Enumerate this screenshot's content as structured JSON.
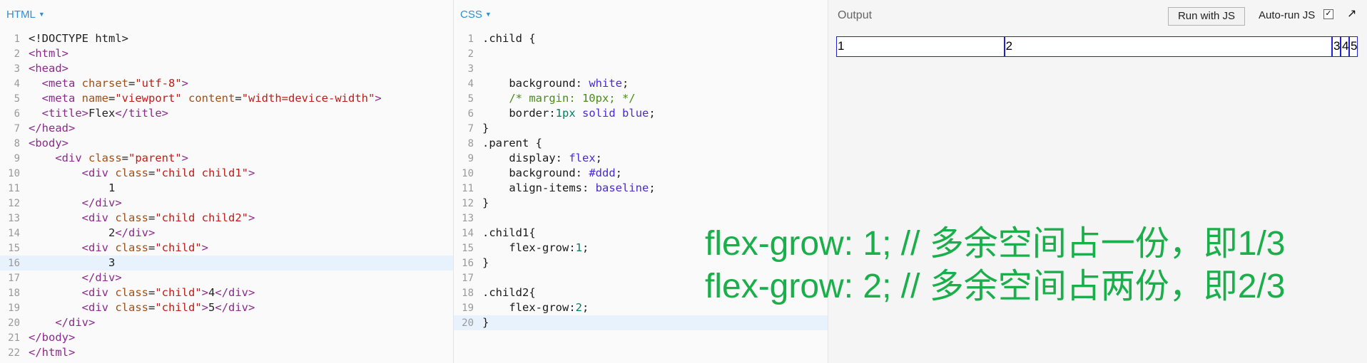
{
  "html_pane": {
    "header": "HTML",
    "lines": [
      {
        "n": "1",
        "tokens": [
          {
            "t": "<!DOCTYPE html>",
            "c": "tok-text"
          }
        ]
      },
      {
        "n": "2",
        "tokens": [
          {
            "t": "<html>",
            "c": "tok-tag"
          }
        ]
      },
      {
        "n": "3",
        "tokens": [
          {
            "t": "<head>",
            "c": "tok-tag"
          }
        ]
      },
      {
        "n": "4",
        "tokens": [
          {
            "t": "  ",
            "c": "tok-text"
          },
          {
            "t": "<meta ",
            "c": "tok-tag"
          },
          {
            "t": "charset",
            "c": "tok-attr"
          },
          {
            "t": "=",
            "c": "tok-text"
          },
          {
            "t": "\"utf-8\"",
            "c": "tok-str"
          },
          {
            "t": ">",
            "c": "tok-tag"
          }
        ]
      },
      {
        "n": "5",
        "tokens": [
          {
            "t": "  ",
            "c": "tok-text"
          },
          {
            "t": "<meta ",
            "c": "tok-tag"
          },
          {
            "t": "name",
            "c": "tok-attr"
          },
          {
            "t": "=",
            "c": "tok-text"
          },
          {
            "t": "\"viewport\"",
            "c": "tok-str"
          },
          {
            "t": " ",
            "c": "tok-text"
          },
          {
            "t": "content",
            "c": "tok-attr"
          },
          {
            "t": "=",
            "c": "tok-text"
          },
          {
            "t": "\"width=device-width\"",
            "c": "tok-str"
          },
          {
            "t": ">",
            "c": "tok-tag"
          }
        ]
      },
      {
        "n": "6",
        "tokens": [
          {
            "t": "  ",
            "c": "tok-text"
          },
          {
            "t": "<title>",
            "c": "tok-tag"
          },
          {
            "t": "Flex",
            "c": "tok-text"
          },
          {
            "t": "</title>",
            "c": "tok-tag"
          }
        ]
      },
      {
        "n": "7",
        "tokens": [
          {
            "t": "</head>",
            "c": "tok-tag"
          }
        ]
      },
      {
        "n": "8",
        "tokens": [
          {
            "t": "<body>",
            "c": "tok-tag"
          }
        ]
      },
      {
        "n": "9",
        "tokens": [
          {
            "t": "    ",
            "c": "tok-text"
          },
          {
            "t": "<div ",
            "c": "tok-tag"
          },
          {
            "t": "class",
            "c": "tok-attr"
          },
          {
            "t": "=",
            "c": "tok-text"
          },
          {
            "t": "\"parent\"",
            "c": "tok-str"
          },
          {
            "t": ">",
            "c": "tok-tag"
          }
        ]
      },
      {
        "n": "10",
        "tokens": [
          {
            "t": "        ",
            "c": "tok-text"
          },
          {
            "t": "<div ",
            "c": "tok-tag"
          },
          {
            "t": "class",
            "c": "tok-attr"
          },
          {
            "t": "=",
            "c": "tok-text"
          },
          {
            "t": "\"child child1\"",
            "c": "tok-str"
          },
          {
            "t": ">",
            "c": "tok-tag"
          }
        ]
      },
      {
        "n": "11",
        "tokens": [
          {
            "t": "            1",
            "c": "tok-text"
          }
        ]
      },
      {
        "n": "12",
        "tokens": [
          {
            "t": "        ",
            "c": "tok-text"
          },
          {
            "t": "</div>",
            "c": "tok-tag"
          }
        ]
      },
      {
        "n": "13",
        "tokens": [
          {
            "t": "        ",
            "c": "tok-text"
          },
          {
            "t": "<div ",
            "c": "tok-tag"
          },
          {
            "t": "class",
            "c": "tok-attr"
          },
          {
            "t": "=",
            "c": "tok-text"
          },
          {
            "t": "\"child child2\"",
            "c": "tok-str"
          },
          {
            "t": ">",
            "c": "tok-tag"
          }
        ]
      },
      {
        "n": "14",
        "tokens": [
          {
            "t": "            2",
            "c": "tok-text"
          },
          {
            "t": "</div>",
            "c": "tok-tag"
          }
        ]
      },
      {
        "n": "15",
        "tokens": [
          {
            "t": "        ",
            "c": "tok-text"
          },
          {
            "t": "<div ",
            "c": "tok-tag"
          },
          {
            "t": "class",
            "c": "tok-attr"
          },
          {
            "t": "=",
            "c": "tok-text"
          },
          {
            "t": "\"child\"",
            "c": "tok-str"
          },
          {
            "t": ">",
            "c": "tok-tag"
          }
        ]
      },
      {
        "n": "16",
        "hl": true,
        "tokens": [
          {
            "t": "            3",
            "c": "tok-text"
          }
        ]
      },
      {
        "n": "17",
        "tokens": [
          {
            "t": "        ",
            "c": "tok-text"
          },
          {
            "t": "</div>",
            "c": "tok-tag"
          }
        ]
      },
      {
        "n": "18",
        "tokens": [
          {
            "t": "        ",
            "c": "tok-text"
          },
          {
            "t": "<div ",
            "c": "tok-tag"
          },
          {
            "t": "class",
            "c": "tok-attr"
          },
          {
            "t": "=",
            "c": "tok-text"
          },
          {
            "t": "\"child\"",
            "c": "tok-str"
          },
          {
            "t": ">",
            "c": "tok-tag"
          },
          {
            "t": "4",
            "c": "tok-text"
          },
          {
            "t": "</div>",
            "c": "tok-tag"
          }
        ]
      },
      {
        "n": "19",
        "tokens": [
          {
            "t": "        ",
            "c": "tok-text"
          },
          {
            "t": "<div ",
            "c": "tok-tag"
          },
          {
            "t": "class",
            "c": "tok-attr"
          },
          {
            "t": "=",
            "c": "tok-text"
          },
          {
            "t": "\"child\"",
            "c": "tok-str"
          },
          {
            "t": ">",
            "c": "tok-tag"
          },
          {
            "t": "5",
            "c": "tok-text"
          },
          {
            "t": "</div>",
            "c": "tok-tag"
          }
        ]
      },
      {
        "n": "20",
        "tokens": [
          {
            "t": "    ",
            "c": "tok-text"
          },
          {
            "t": "</div>",
            "c": "tok-tag"
          }
        ]
      },
      {
        "n": "21",
        "tokens": [
          {
            "t": "</body>",
            "c": "tok-tag"
          }
        ]
      },
      {
        "n": "22",
        "tokens": [
          {
            "t": "</html>",
            "c": "tok-tag"
          }
        ]
      }
    ]
  },
  "css_pane": {
    "header": "CSS",
    "lines": [
      {
        "n": "1",
        "tokens": [
          {
            "t": ".child {",
            "c": "tok-sel"
          }
        ]
      },
      {
        "n": "2",
        "tokens": []
      },
      {
        "n": "3",
        "tokens": []
      },
      {
        "n": "4",
        "tokens": [
          {
            "t": "    ",
            "c": "tok-text"
          },
          {
            "t": "background",
            "c": "tok-prop"
          },
          {
            "t": ": ",
            "c": "tok-text"
          },
          {
            "t": "white",
            "c": "tok-val"
          },
          {
            "t": ";",
            "c": "tok-text"
          }
        ]
      },
      {
        "n": "5",
        "tokens": [
          {
            "t": "    ",
            "c": "tok-text"
          },
          {
            "t": "/* margin: 10px; */",
            "c": "tok-comment"
          }
        ]
      },
      {
        "n": "6",
        "tokens": [
          {
            "t": "    ",
            "c": "tok-text"
          },
          {
            "t": "border",
            "c": "tok-prop"
          },
          {
            "t": ":",
            "c": "tok-text"
          },
          {
            "t": "1px",
            "c": "tok-num"
          },
          {
            "t": " ",
            "c": "tok-text"
          },
          {
            "t": "solid",
            "c": "tok-val"
          },
          {
            "t": " ",
            "c": "tok-text"
          },
          {
            "t": "blue",
            "c": "tok-val"
          },
          {
            "t": ";",
            "c": "tok-text"
          }
        ]
      },
      {
        "n": "7",
        "tokens": [
          {
            "t": "}",
            "c": "tok-sel"
          }
        ]
      },
      {
        "n": "8",
        "tokens": [
          {
            "t": ".parent {",
            "c": "tok-sel"
          }
        ]
      },
      {
        "n": "9",
        "tokens": [
          {
            "t": "    ",
            "c": "tok-text"
          },
          {
            "t": "display",
            "c": "tok-prop"
          },
          {
            "t": ": ",
            "c": "tok-text"
          },
          {
            "t": "flex",
            "c": "tok-val"
          },
          {
            "t": ";",
            "c": "tok-text"
          }
        ]
      },
      {
        "n": "10",
        "tokens": [
          {
            "t": "    ",
            "c": "tok-text"
          },
          {
            "t": "background",
            "c": "tok-prop"
          },
          {
            "t": ": ",
            "c": "tok-text"
          },
          {
            "t": "#ddd",
            "c": "tok-val"
          },
          {
            "t": ";",
            "c": "tok-text"
          }
        ]
      },
      {
        "n": "11",
        "tokens": [
          {
            "t": "    ",
            "c": "tok-text"
          },
          {
            "t": "align-items",
            "c": "tok-prop"
          },
          {
            "t": ": ",
            "c": "tok-text"
          },
          {
            "t": "baseline",
            "c": "tok-val"
          },
          {
            "t": ";",
            "c": "tok-text"
          }
        ]
      },
      {
        "n": "12",
        "tokens": [
          {
            "t": "}",
            "c": "tok-sel"
          }
        ]
      },
      {
        "n": "13",
        "tokens": []
      },
      {
        "n": "14",
        "tokens": [
          {
            "t": ".child1{",
            "c": "tok-sel"
          }
        ]
      },
      {
        "n": "15",
        "tokens": [
          {
            "t": "    ",
            "c": "tok-text"
          },
          {
            "t": "flex-grow",
            "c": "tok-prop"
          },
          {
            "t": ":",
            "c": "tok-text"
          },
          {
            "t": "1",
            "c": "tok-num"
          },
          {
            "t": ";",
            "c": "tok-text"
          }
        ]
      },
      {
        "n": "16",
        "tokens": [
          {
            "t": "}",
            "c": "tok-sel"
          }
        ]
      },
      {
        "n": "17",
        "tokens": []
      },
      {
        "n": "18",
        "tokens": [
          {
            "t": ".child2{",
            "c": "tok-sel"
          }
        ]
      },
      {
        "n": "19",
        "tokens": [
          {
            "t": "    ",
            "c": "tok-text"
          },
          {
            "t": "flex-grow",
            "c": "tok-prop"
          },
          {
            "t": ":",
            "c": "tok-text"
          },
          {
            "t": "2",
            "c": "tok-num"
          },
          {
            "t": ";",
            "c": "tok-text"
          }
        ]
      },
      {
        "n": "20",
        "hl": true,
        "tokens": [
          {
            "t": "}",
            "c": "tok-sel"
          }
        ]
      }
    ]
  },
  "output_pane": {
    "title": "Output",
    "run_button": "Run with JS",
    "autorun_label": "Auto-run JS",
    "autorun_checked": "✓",
    "popout_icon": "↗",
    "children": [
      "1",
      "2",
      "3",
      "4",
      "5"
    ]
  },
  "annotations": {
    "line1": "flex-grow: 1; // 多余空间占一份，即1/3",
    "line2": "flex-grow: 2; // 多余空间占两份，即2/3",
    "color": "#1aaf4a"
  }
}
